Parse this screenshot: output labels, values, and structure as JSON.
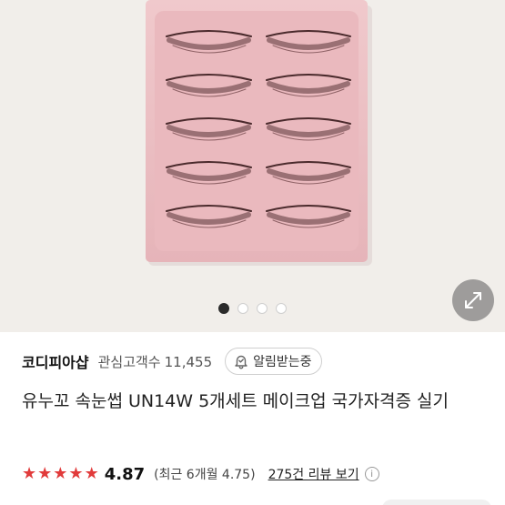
{
  "product_image": {
    "current_slide": 1,
    "slides": [
      1,
      2,
      3,
      4
    ],
    "zoom_icon": "expand-arrows-icon"
  },
  "seller": {
    "name": "코디피아샵",
    "followers_label": "관심고객수",
    "followers_count": "11,455",
    "alarm_button": "알림받는중",
    "alarm_icon": "bell-check-icon"
  },
  "product": {
    "title": "유누꼬 속눈썹 UN14W 5개세트 메이크업 국가자격증 실기"
  },
  "rating": {
    "stars": 5,
    "star_color": "#e13b3b",
    "score": "4.87",
    "recent": "(최근 6개월 4.75)",
    "review_link": "275건 리뷰 보기",
    "info_icon": "info-icon"
  },
  "colors": {
    "accent": "#e13b3b",
    "tray_pink": "#e9bcc0"
  }
}
